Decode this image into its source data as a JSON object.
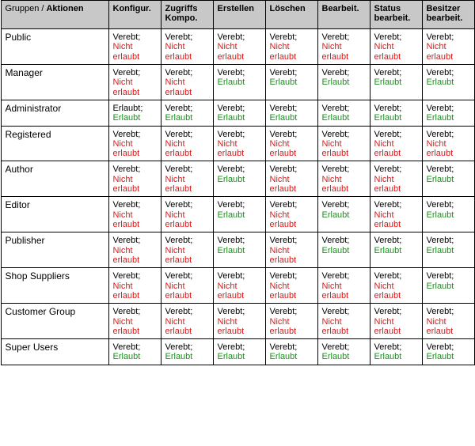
{
  "header": {
    "groups_label_prefix": "Gruppen",
    "groups_label_slash": " / ",
    "groups_label_bold": "Aktionen",
    "actions": [
      "Konfigur.",
      "Zugriffs Kompo.",
      "Erstellen",
      "Löschen",
      "Bearbeit.",
      "Status bearbeit.",
      "Besitzer bearbeit."
    ]
  },
  "strings": {
    "inherited": "Verebt;",
    "allowed_only": "Erlaubt;",
    "allowed": "Erlaubt",
    "not_allowed": "Nicht erlaubt"
  },
  "rows": [
    {
      "name": "Public",
      "cells": [
        "deny",
        "deny",
        "deny",
        "deny",
        "deny",
        "deny",
        "deny"
      ]
    },
    {
      "name": "Manager",
      "cells": [
        "deny",
        "deny",
        "allow",
        "allow",
        "allow",
        "allow",
        "allow"
      ]
    },
    {
      "name": "Administrator",
      "cells": [
        "allow_only",
        "allow",
        "allow",
        "allow",
        "allow",
        "allow",
        "allow"
      ]
    },
    {
      "name": "Registered",
      "cells": [
        "deny",
        "deny",
        "deny",
        "deny",
        "deny",
        "deny",
        "deny"
      ]
    },
    {
      "name": "Author",
      "cells": [
        "deny",
        "deny",
        "allow",
        "deny",
        "deny",
        "deny",
        "allow"
      ]
    },
    {
      "name": "Editor",
      "cells": [
        "deny",
        "deny",
        "allow",
        "deny",
        "allow",
        "deny",
        "allow"
      ]
    },
    {
      "name": "Publisher",
      "cells": [
        "deny",
        "deny",
        "allow",
        "deny",
        "allow",
        "allow",
        "allow"
      ]
    },
    {
      "name": "Shop Suppliers",
      "cells": [
        "deny",
        "deny",
        "deny",
        "deny",
        "deny",
        "deny",
        "allow"
      ]
    },
    {
      "name": "Customer Group",
      "cells": [
        "deny",
        "deny",
        "deny",
        "deny",
        "deny",
        "deny",
        "deny"
      ]
    },
    {
      "name": "Super Users",
      "cells": [
        "allow",
        "allow",
        "allow",
        "allow",
        "allow",
        "allow",
        "allow"
      ]
    }
  ]
}
